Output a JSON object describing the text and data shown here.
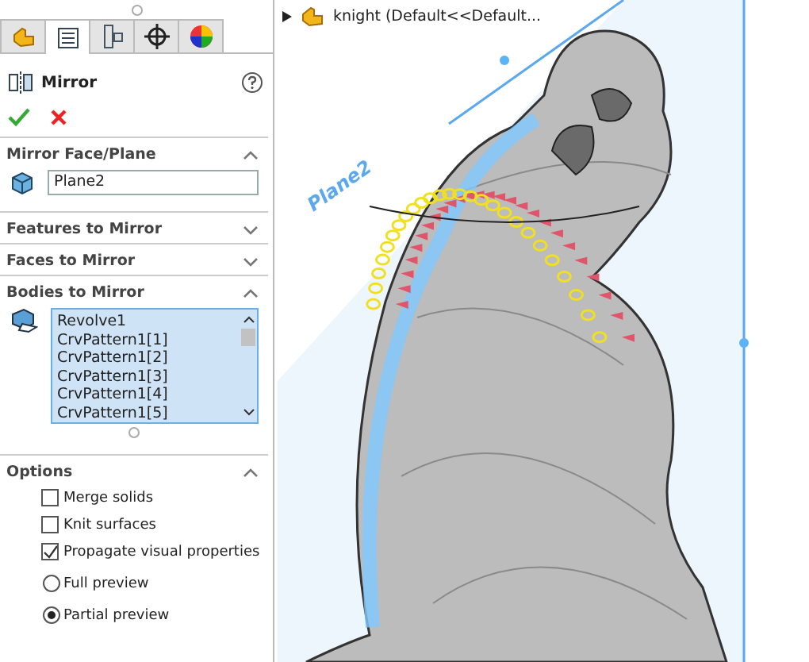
{
  "tabs": [
    {
      "kind": "part",
      "selected": false
    },
    {
      "kind": "tree",
      "selected": true
    },
    {
      "kind": "config",
      "selected": false
    },
    {
      "kind": "target",
      "selected": false
    },
    {
      "kind": "appearance",
      "selected": false
    }
  ],
  "feature": {
    "title": "Mirror"
  },
  "sections": [
    {
      "title": "Mirror Face/Plane",
      "expanded": true,
      "kind": "field",
      "value": "Plane2"
    },
    {
      "title": "Features to Mirror",
      "expanded": false
    },
    {
      "title": "Faces to Mirror",
      "expanded": false
    },
    {
      "title": "Bodies to Mirror",
      "expanded": true,
      "kind": "list",
      "items": [
        "Revolve1",
        "CrvPattern1[1]",
        "CrvPattern1[2]",
        "CrvPattern1[3]",
        "CrvPattern1[4]",
        "CrvPattern1[5]"
      ]
    },
    {
      "title": "Options",
      "expanded": true,
      "kind": "options",
      "options": [
        {
          "kind": "checkbox",
          "label": "Merge solids",
          "checked": false
        },
        {
          "kind": "checkbox",
          "label": "Knit surfaces",
          "checked": false
        },
        {
          "kind": "checkbox",
          "label": "Propagate visual properties",
          "checked": true
        },
        {
          "kind": "radio",
          "label": "Full preview",
          "selected": false
        },
        {
          "kind": "radio",
          "label": "Partial preview",
          "selected": true
        }
      ]
    }
  ],
  "viewport": {
    "breadcrumb": "knight  (Default<<Default...",
    "plane_label": "Plane2"
  }
}
